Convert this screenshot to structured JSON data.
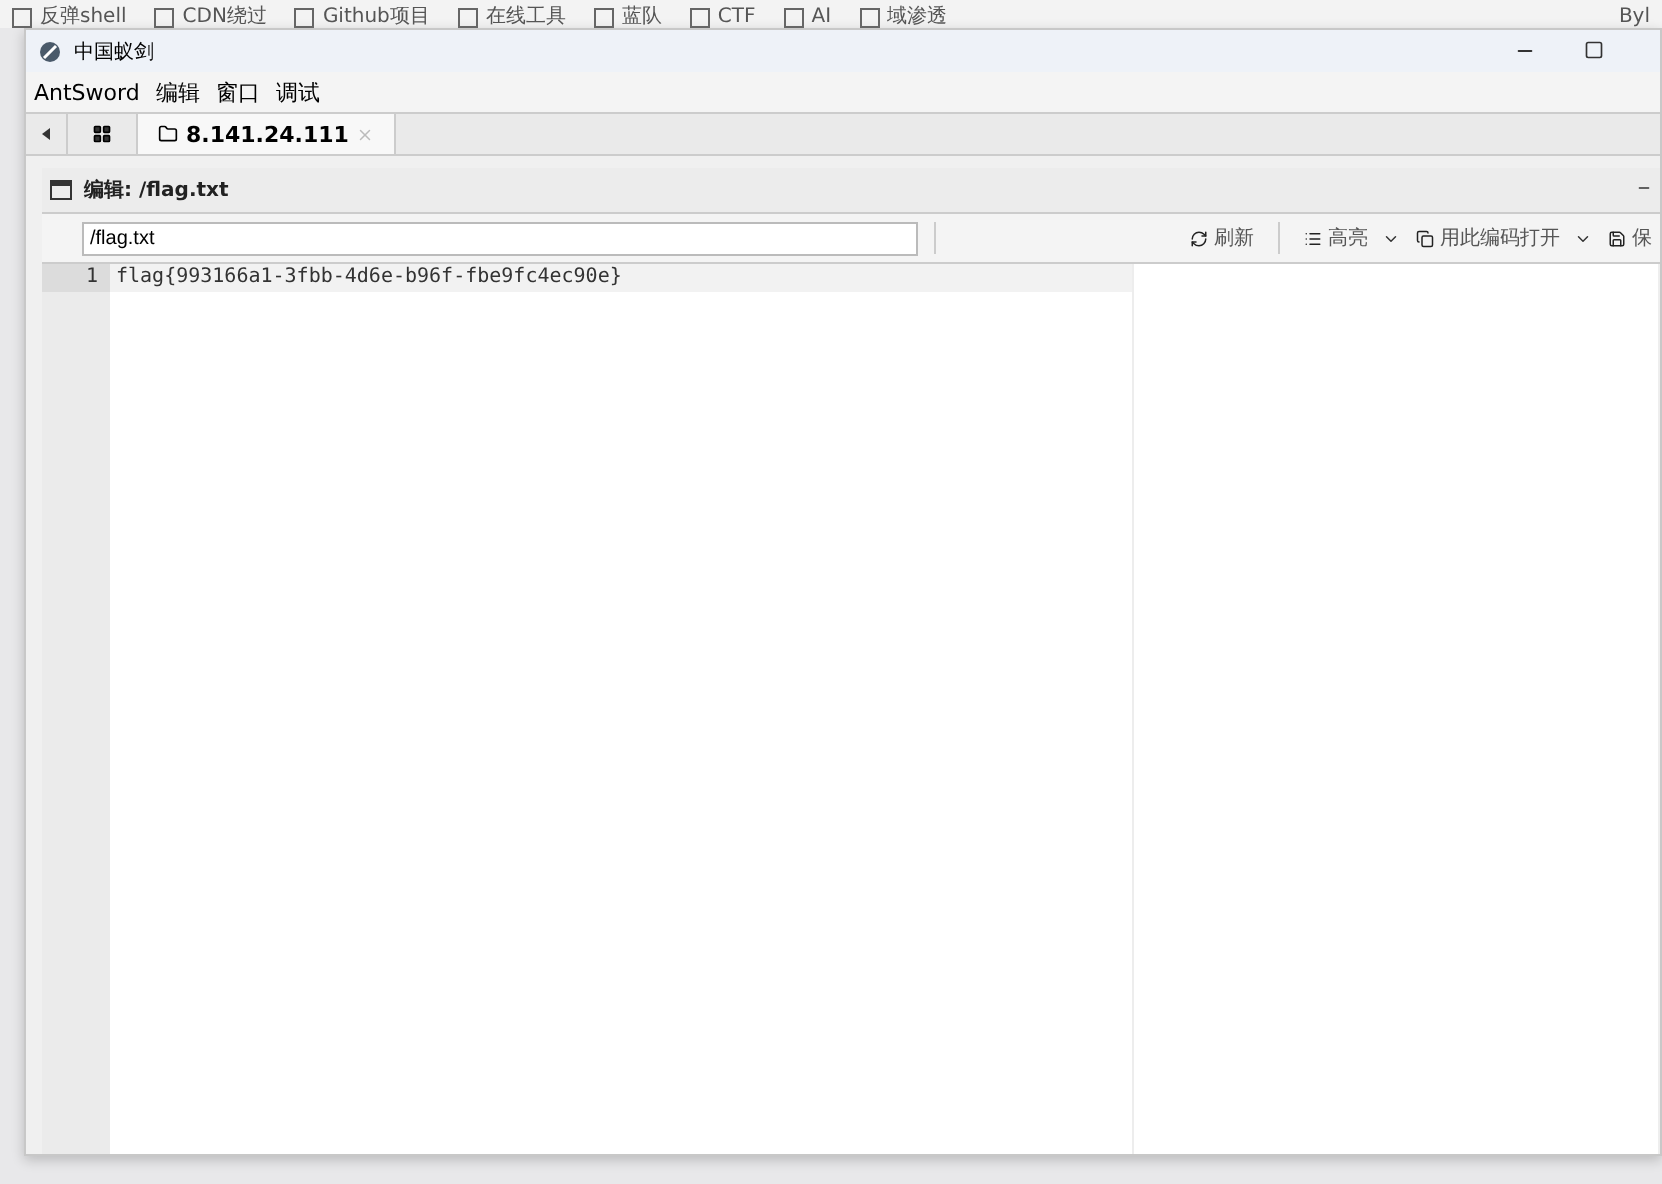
{
  "bookmarks": [
    "反弹shell",
    "CDN绕过",
    "Github项目",
    "在线工具",
    "蓝队",
    "CTF",
    "AI",
    "域渗透"
  ],
  "bookmarks_right": "Byl",
  "window": {
    "title": "中国蚁剑"
  },
  "menu": [
    "AntSword",
    "编辑",
    "窗口",
    "调试"
  ],
  "tabs": [
    {
      "label": "8.141.24.111",
      "selected": true
    }
  ],
  "panel": {
    "title": "编辑: /flag.txt",
    "path": "/flag.txt",
    "toolbar": [
      {
        "kind": "button",
        "label": "刷新"
      },
      {
        "kind": "dropdown",
        "label": "高亮"
      },
      {
        "kind": "dropdown",
        "label": "用此编码打开"
      },
      {
        "kind": "button",
        "label": "保"
      }
    ]
  },
  "editor": {
    "lines": [
      {
        "number": "1",
        "text": "flag{993166a1-3fbb-4d6e-b96f-fbe9fc4ec90e}"
      }
    ]
  }
}
